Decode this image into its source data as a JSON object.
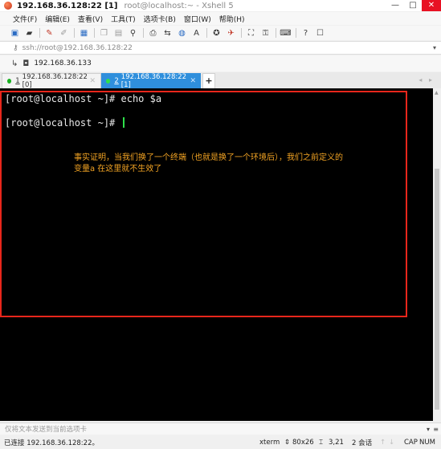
{
  "window": {
    "title_main": "192.168.36.128:22 [1]",
    "title_sub": "root@localhost:~ - Xshell 5",
    "minimize": "—",
    "maximize": "□",
    "close": "✕"
  },
  "menu": [
    "文件(F)",
    "编辑(E)",
    "查看(V)",
    "工具(T)",
    "选项卡(B)",
    "窗口(W)",
    "帮助(H)"
  ],
  "address": {
    "value": "ssh://root@192.168.36.128:22"
  },
  "session": {
    "host": "192.168.36.133"
  },
  "tabs": [
    {
      "number": "1",
      "label": "192.168.36.128:22 [0]",
      "active": false
    },
    {
      "number": "2",
      "label": "192.168.36.128:22 [1]",
      "active": true
    }
  ],
  "terminal": {
    "line1": "[root@localhost ~]# echo $a",
    "line2": "[root@localhost ~]# ",
    "annotation_line1": "事实证明，当我们换了一个终端（也就是换了一个环境后），我们之前定义的",
    "annotation_line2": "变量a 在这里就不生效了"
  },
  "compose": {
    "placeholder": "仅将文本发送到当前选项卡"
  },
  "status": {
    "connection": "已连接 192.168.36.128:22。",
    "terminal_type": "xterm",
    "size": "80x26",
    "cursor_pos": "3,21",
    "sessions": "2 会话",
    "cap": "CAP",
    "num": "NUM"
  },
  "colors": {
    "terminal_bg": "#000000",
    "annotation": "#f2a323",
    "highlight_border": "#e8261b",
    "active_tab": "#2f8fdc",
    "cursor": "#2fe04a"
  }
}
